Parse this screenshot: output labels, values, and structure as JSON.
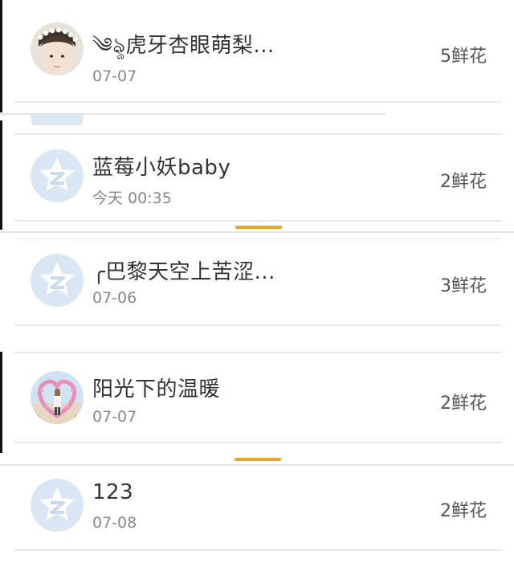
{
  "colors": {
    "accent": "#f0a224",
    "default_avatar": "#dbe6f4",
    "default_avatar_icon": "#ffffff"
  },
  "rows": [
    {
      "name": "༄ৡ虎牙杏眼萌梨...",
      "date": "07-07",
      "flowers": "5鲜花",
      "avatar": "photo-boy-flower-crown"
    },
    {
      "name": "蓝莓小妖baby",
      "date": "今天 00:35",
      "flowers": "2鲜花",
      "avatar": "default-star-avatar"
    },
    {
      "name": "╭巴黎天空上苦涩...",
      "date": "07-06",
      "flowers": "3鲜花",
      "avatar": "default-star-avatar"
    },
    {
      "name": "阳光下的温暖",
      "date": "07-07",
      "flowers": "2鲜花",
      "avatar": "photo-heart-arch"
    },
    {
      "name": "123",
      "date": "07-08",
      "flowers": "2鲜花",
      "avatar": "default-star-avatar"
    }
  ]
}
